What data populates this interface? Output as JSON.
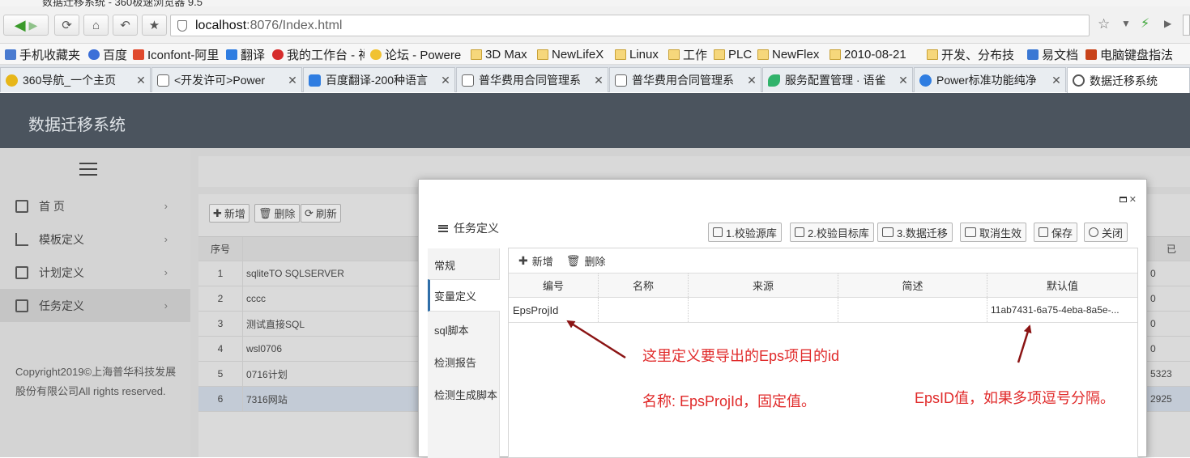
{
  "browser": {
    "window_title": "数据迁移系统 - 360极速浏览器 9.5",
    "address": {
      "host": "localhost",
      "rest": ":8076/Index.html"
    },
    "bookmarks": [
      {
        "label": "手机收藏夹",
        "icon": "phone-icon"
      },
      {
        "label": "百度",
        "icon": "baidu-icon"
      },
      {
        "label": "Iconfont-阿里",
        "icon": "iconfont-icon"
      },
      {
        "label": "翻译",
        "icon": "translate-icon"
      },
      {
        "label": "我的工作台 - 禅",
        "icon": "zentao-icon"
      },
      {
        "label": "论坛 - Powere",
        "icon": "forum-icon"
      },
      {
        "label": "3D Max",
        "icon": "folder-icon"
      },
      {
        "label": "NewLifeX",
        "icon": "folder-icon"
      },
      {
        "label": "Linux",
        "icon": "folder-icon"
      },
      {
        "label": "工作",
        "icon": "folder-icon"
      },
      {
        "label": "PLC",
        "icon": "folder-icon"
      },
      {
        "label": "NewFlex",
        "icon": "folder-icon"
      },
      {
        "label": "2010-08-21",
        "icon": "folder-icon"
      },
      {
        "label": "开发、分布技",
        "icon": "folder-icon"
      },
      {
        "label": "易文档",
        "icon": "doc-icon"
      },
      {
        "label": "电脑键盘指法",
        "icon": "keyboard-icon"
      }
    ],
    "tabs": [
      {
        "label": "360导航_一个主页",
        "icon_color": "#e7b619"
      },
      {
        "label": "<开发许可>Power",
        "icon_color": "#ffffff"
      },
      {
        "label": "百度翻译-200种语言",
        "icon_color": "#2f7de1"
      },
      {
        "label": "普华费用合同管理系",
        "icon_color": "#ffffff"
      },
      {
        "label": "普华费用合同管理系",
        "icon_color": "#ffffff"
      },
      {
        "label": "服务配置管理 · 语雀",
        "icon_color": "#31b36b"
      },
      {
        "label": "Power标准功能纯净",
        "icon_color": "#2f7de1"
      },
      {
        "label": "数据迁移系统",
        "icon_color": "#555555"
      }
    ]
  },
  "app": {
    "title": "数据迁移系统",
    "menu": [
      {
        "label": "首 页",
        "icon": "home-icon"
      },
      {
        "label": "模板定义",
        "icon": "chart-icon"
      },
      {
        "label": "计划定义",
        "icon": "plan-icon"
      },
      {
        "label": "任务定义",
        "icon": "task-icon"
      }
    ],
    "copyright": "Copyright2019©上海普华科技发展股份有限公司All rights reserved.",
    "main_buttons": [
      "新增",
      "删除",
      "刷新"
    ],
    "table": {
      "header_no": "序号",
      "rows": [
        {
          "no": "1",
          "name": "sqliteTO SQLSERVER",
          "right": "0"
        },
        {
          "no": "2",
          "name": "cccc",
          "right": "0"
        },
        {
          "no": "3",
          "name": "测试直接SQL",
          "right": "0"
        },
        {
          "no": "4",
          "name": "wsl0706",
          "right": "0"
        },
        {
          "no": "5",
          "name": "0716计划",
          "right": "5323"
        },
        {
          "no": "6",
          "name": "7316网站",
          "right": "2925"
        }
      ],
      "right_header": "已"
    }
  },
  "modal": {
    "title": "任务定义",
    "toolbar": [
      "1.校验源库",
      "2.校验目标库",
      "3.数据迁移",
      "取消生效",
      "保存",
      "关闭"
    ],
    "side_tabs": [
      "常规",
      "变量定义",
      "sql脚本",
      "检测报告",
      "检测生成脚本"
    ],
    "selected_tab": 1,
    "inner_buttons": {
      "add": "新增",
      "delete": "删除"
    },
    "columns": [
      "编号",
      "名称",
      "来源",
      "简述",
      "默认值"
    ],
    "rows": [
      {
        "code": "EpsProjId",
        "name": "",
        "source": "",
        "desc": "",
        "default": "11ab7431-6a75-4eba-8a5e-..."
      }
    ]
  },
  "annotations": {
    "note1": "这里定义要导出的Eps项目的id",
    "note2": "名称: EpsProjId，固定值。",
    "note3": "EpsID值，如果多项逗号分隔。",
    "color": "#e02a2a",
    "arrow_color": "#8b1414"
  }
}
